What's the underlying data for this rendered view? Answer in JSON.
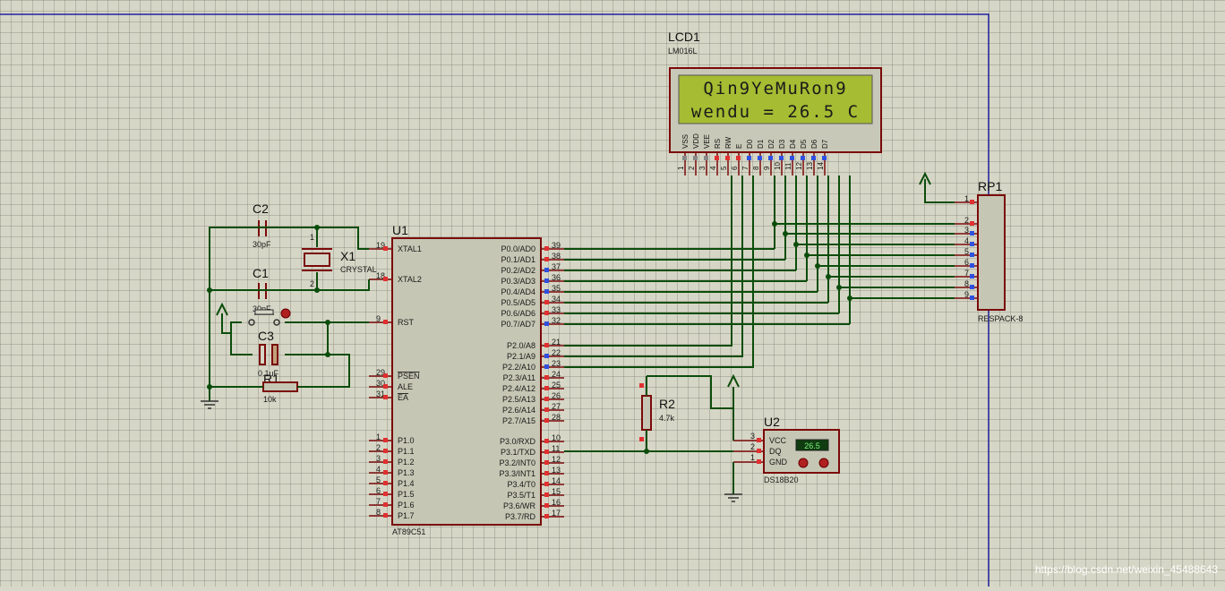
{
  "lcd": {
    "ref": "LCD1",
    "model": "LM016L",
    "line1": "Qin9YeMuRon9",
    "line2": "wendu = 26.5 C",
    "pin_labels": [
      "VSS",
      "VDD",
      "VEE",
      "RS",
      "RW",
      "E",
      "D0",
      "D1",
      "D2",
      "D3",
      "D4",
      "D5",
      "D6",
      "D7"
    ],
    "pin_numbers": [
      "1",
      "2",
      "3",
      "4",
      "5",
      "6",
      "7",
      "8",
      "9",
      "10",
      "11",
      "12",
      "13",
      "14"
    ]
  },
  "mcu": {
    "ref": "U1",
    "model": "AT89C51",
    "left_pins": [
      {
        "n": "19",
        "l": "XTAL1"
      },
      {
        "n": "18",
        "l": "XTAL2"
      },
      {
        "n": "9",
        "l": "RST"
      },
      {
        "n": "29",
        "l": "PSEN"
      },
      {
        "n": "30",
        "l": "ALE"
      },
      {
        "n": "31",
        "l": "EA"
      },
      {
        "n": "1",
        "l": "P1.0"
      },
      {
        "n": "2",
        "l": "P1.1"
      },
      {
        "n": "3",
        "l": "P1.2"
      },
      {
        "n": "4",
        "l": "P1.3"
      },
      {
        "n": "5",
        "l": "P1.4"
      },
      {
        "n": "6",
        "l": "P1.5"
      },
      {
        "n": "7",
        "l": "P1.6"
      },
      {
        "n": "8",
        "l": "P1.7"
      }
    ],
    "right_pins": [
      {
        "n": "39",
        "l": "P0.0/AD0"
      },
      {
        "n": "38",
        "l": "P0.1/AD1"
      },
      {
        "n": "37",
        "l": "P0.2/AD2"
      },
      {
        "n": "36",
        "l": "P0.3/AD3"
      },
      {
        "n": "35",
        "l": "P0.4/AD4"
      },
      {
        "n": "34",
        "l": "P0.5/AD5"
      },
      {
        "n": "33",
        "l": "P0.6/AD6"
      },
      {
        "n": "32",
        "l": "P0.7/AD7"
      },
      {
        "n": "21",
        "l": "P2.0/A8"
      },
      {
        "n": "22",
        "l": "P2.1/A9"
      },
      {
        "n": "23",
        "l": "P2.2/A10"
      },
      {
        "n": "24",
        "l": "P2.3/A11"
      },
      {
        "n": "25",
        "l": "P2.4/A12"
      },
      {
        "n": "26",
        "l": "P2.5/A13"
      },
      {
        "n": "27",
        "l": "P2.6/A14"
      },
      {
        "n": "28",
        "l": "P2.7/A15"
      },
      {
        "n": "10",
        "l": "P3.0/RXD"
      },
      {
        "n": "11",
        "l": "P3.1/TXD"
      },
      {
        "n": "12",
        "l": "P3.2/INT0"
      },
      {
        "n": "13",
        "l": "P3.3/INT1"
      },
      {
        "n": "14",
        "l": "P3.4/T0"
      },
      {
        "n": "15",
        "l": "P3.5/T1"
      },
      {
        "n": "16",
        "l": "P3.6/WR"
      },
      {
        "n": "17",
        "l": "P3.7/RD"
      }
    ]
  },
  "c2": {
    "ref": "C2",
    "value": "30pF"
  },
  "c1": {
    "ref": "C1",
    "value": "30pF"
  },
  "c3": {
    "ref": "C3",
    "value": "0.1uF"
  },
  "x1": {
    "ref": "X1",
    "value": "CRYSTAL",
    "pin1": "1",
    "pin2": "2"
  },
  "r1": {
    "ref": "R1",
    "value": "10k"
  },
  "r2": {
    "ref": "R2",
    "value": "4.7k"
  },
  "rp1": {
    "ref": "RP1",
    "model": "RESPACK-8",
    "pins": [
      "1",
      "2",
      "3",
      "4",
      "5",
      "6",
      "7",
      "8",
      "9"
    ]
  },
  "u2": {
    "ref": "U2",
    "model": "DS18B20",
    "pins": [
      {
        "n": "3",
        "l": "VCC"
      },
      {
        "n": "2",
        "l": "DQ"
      },
      {
        "n": "1",
        "l": "GND"
      }
    ],
    "display": "26.5"
  },
  "watermark": "https://blog.csdn.net/weixin_45488643"
}
